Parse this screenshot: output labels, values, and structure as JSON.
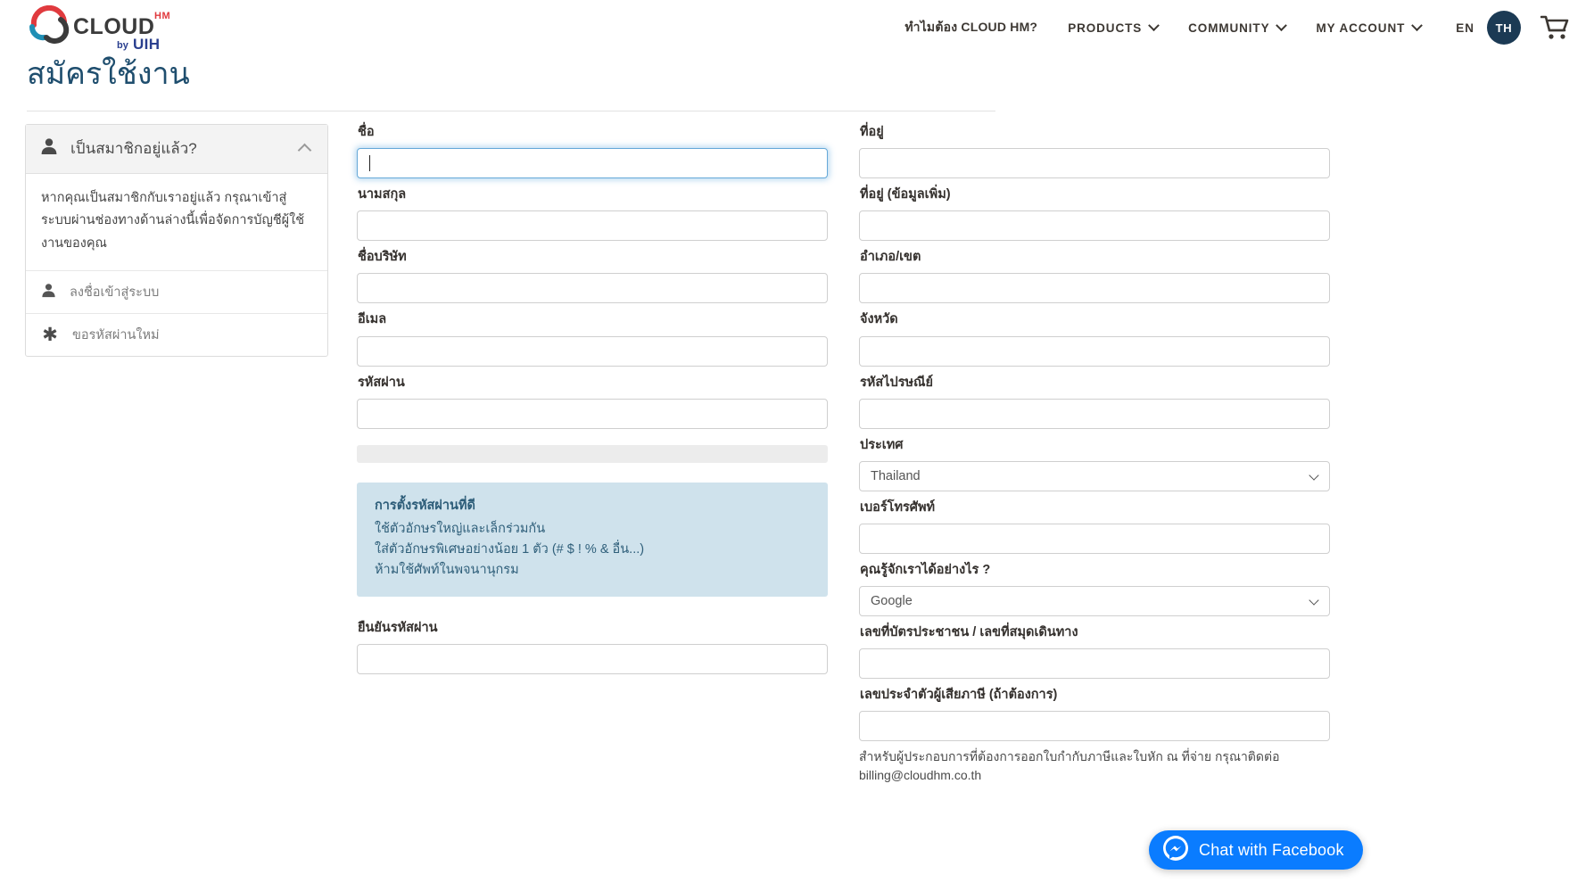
{
  "header": {
    "logo": {
      "name": "cloud-hm-logo",
      "wordmark": "CLOUD",
      "superscript": "HM",
      "by_text": "by",
      "parent_brand": "UIH"
    },
    "nav": [
      {
        "label": "ทำไมต้อง CLOUD HM?",
        "has_dropdown": false,
        "thai": true
      },
      {
        "label": "PRODUCTS",
        "has_dropdown": true,
        "thai": false
      },
      {
        "label": "COMMUNITY",
        "has_dropdown": true,
        "thai": false
      },
      {
        "label": "MY ACCOUNT",
        "has_dropdown": true,
        "thai": false
      }
    ],
    "lang_inactive": "EN",
    "lang_active": "TH",
    "cart_icon": "shopping-cart-icon"
  },
  "page": {
    "title": "สมัครใช้งาน"
  },
  "sidebar": {
    "header_title": "เป็นสมาชิกอยู่แล้ว?",
    "header_icon": "person-icon",
    "collapse_icon": "chevron-up-icon",
    "body_text": "หากคุณเป็นสมาชิกกับเราอยู่แล้ว กรุณาเข้าสู่ระบบผ่านช่องทางด้านล่างนี้เพื่อจัดการบัญชีผู้ใช้งานของคุณ",
    "links": [
      {
        "label": "ลงชื่อเข้าสู่ระบบ",
        "icon": "person-icon"
      },
      {
        "label": "ขอรหัสผ่านใหม่",
        "icon": "asterisk-icon"
      }
    ]
  },
  "form": {
    "left_column": {
      "first_name": {
        "label": "ชื่อ",
        "value": "",
        "placeholder": "",
        "focused": true
      },
      "last_name": {
        "label": "นามสกุล",
        "value": "",
        "placeholder": ""
      },
      "company": {
        "label": "ชื่อบริษัท",
        "value": "",
        "placeholder": ""
      },
      "email": {
        "label": "อีเมล",
        "value": "",
        "placeholder": ""
      },
      "password": {
        "label": "รหัสผ่าน",
        "value": "",
        "placeholder": ""
      },
      "password_strength": {
        "name": "password-strength-meter",
        "percent": 0
      },
      "password_tips": {
        "title": "การตั้งรหัสผ่านที่ดี",
        "lines": [
          "ใช้ตัวอักษรใหญ่และเล็กร่วมกัน",
          "ใส่ตัวอักษรพิเศษอย่างน้อย 1 ตัว (# $ ! % & อื่น...)",
          "ห้ามใช้ศัพท์ในพจนานุกรม"
        ]
      },
      "confirm_password": {
        "label": "ยืนยันรหัสผ่าน",
        "value": "",
        "placeholder": ""
      }
    },
    "right_column": {
      "address": {
        "label": "ที่อยู่",
        "value": "",
        "placeholder": ""
      },
      "address_extra": {
        "label": "ที่อยู่ (ข้อมูลเพิ่ม)",
        "value": "",
        "placeholder": ""
      },
      "district": {
        "label": "อำเภอ/เขต",
        "value": "",
        "placeholder": ""
      },
      "province": {
        "label": "จังหวัด",
        "value": "",
        "placeholder": ""
      },
      "postcode": {
        "label": "รหัสไปรษณีย์",
        "value": "",
        "placeholder": ""
      },
      "country": {
        "label": "ประเทศ",
        "selected": "Thailand"
      },
      "phone": {
        "label": "เบอร์โทรศัพท์",
        "value": "",
        "placeholder": ""
      },
      "referral": {
        "label": "คุณรู้จักเราได้อย่างไร ?",
        "selected": "Google"
      },
      "national_id": {
        "label": "เลขที่บัตรประชาชน / เลขที่สมุดเดินทาง",
        "value": "",
        "placeholder": ""
      },
      "tax_id": {
        "label": "เลขประจำตัวผู้เสียภาษี (ถ้าต้องการ)",
        "value": "",
        "placeholder": ""
      },
      "tax_note": "สำหรับผู้ประกอบการที่ต้องการออกใบกำกับภาษีและใบหัก ณ ที่จ่าย กรุณาติดต่อ billing@cloudhm.co.th"
    }
  },
  "chat_widget": {
    "label": "Chat with Facebook",
    "icon": "messenger-icon",
    "color": "#0a7cff"
  },
  "colors": {
    "title_blue": "#1f4e6e",
    "focus_blue": "#66a9d8",
    "tips_bg": "#cfe2ec",
    "badge_navy": "#1b3a54",
    "logo_red": "#e03a3e",
    "logo_teal": "#1f8fb5",
    "logo_dark": "#3b3b3b"
  }
}
